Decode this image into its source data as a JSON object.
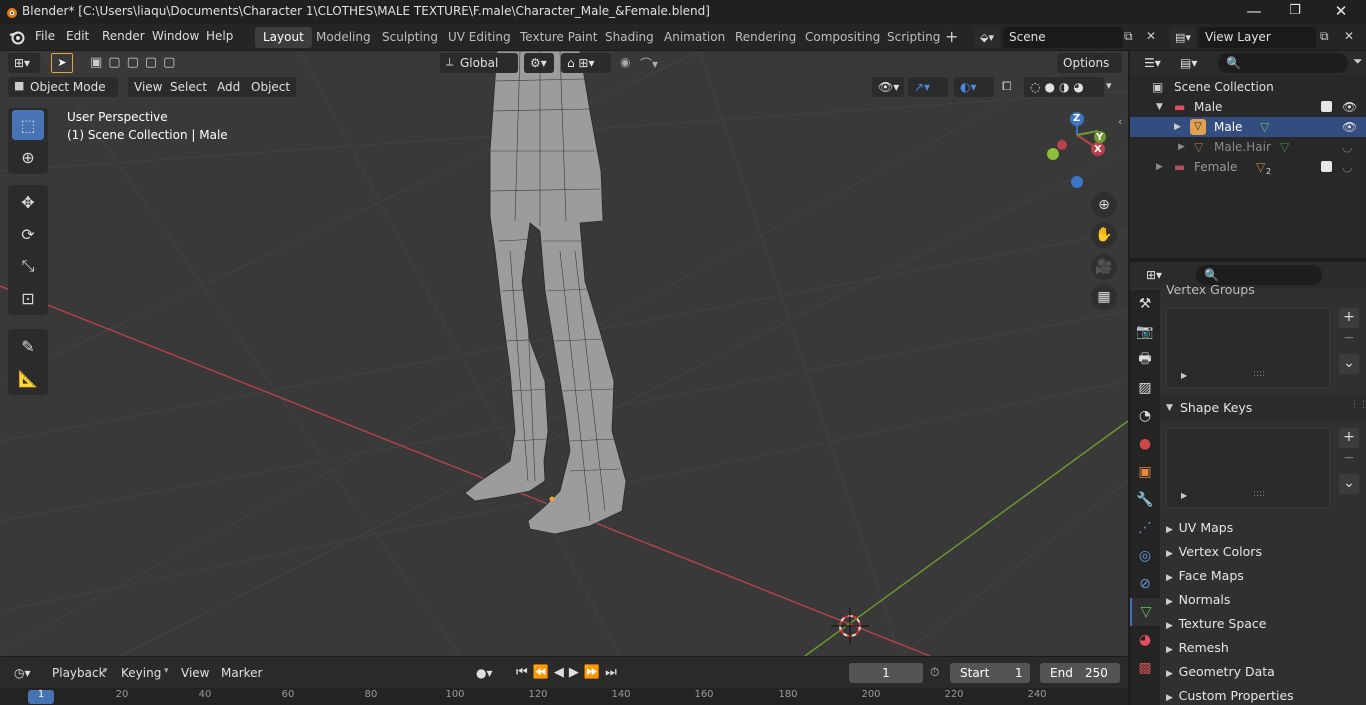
{
  "window": {
    "title": "Blender* [C:\\Users\\liaqu\\Documents\\Character 1\\CLOTHES\\MALE TEXTURE\\F.male\\Character_Male_&Female.blend]",
    "minimize": "—",
    "maximize": "❐",
    "close": "✕"
  },
  "menu": [
    "File",
    "Edit",
    "Render",
    "Window",
    "Help"
  ],
  "workspaces": [
    "Layout",
    "Modeling",
    "Sculpting",
    "UV Editing",
    "Texture Paint",
    "Shading",
    "Animation",
    "Rendering",
    "Compositing",
    "Scripting"
  ],
  "active_workspace": "Layout",
  "scene": {
    "name": "Scene",
    "view_layer": "View Layer"
  },
  "viewport": {
    "transform_orientation": "Global",
    "options_label": "Options",
    "mode": "Object Mode",
    "menus": [
      "View",
      "Select",
      "Add",
      "Object"
    ],
    "perspective_label": "User Perspective",
    "collection_label": "(1) Scene Collection | Male",
    "gizmo_axes": {
      "z": "Z",
      "y": "Y",
      "x": "X"
    }
  },
  "outliner": {
    "root": "Scene Collection",
    "items": [
      {
        "label": "Male",
        "kind": "collection"
      },
      {
        "label": "Male",
        "kind": "object",
        "selected": true
      },
      {
        "label": "Male.Hair",
        "kind": "object"
      },
      {
        "label": "Female",
        "kind": "collection",
        "badge": "2"
      }
    ]
  },
  "properties": {
    "panels": {
      "vertex_groups": "Vertex Groups",
      "shape_keys": "Shape Keys",
      "collapsed": [
        "UV Maps",
        "Vertex Colors",
        "Face Maps",
        "Normals",
        "Texture Space",
        "Remesh",
        "Geometry Data",
        "Custom Properties"
      ]
    }
  },
  "timeline": {
    "menus": [
      "Playback",
      "Keying",
      "View",
      "Marker"
    ],
    "current_frame": "1",
    "start_label": "Start",
    "start": "1",
    "end_label": "End",
    "end": "250",
    "ruler_ticks": [
      "1",
      "20",
      "40",
      "60",
      "80",
      "100",
      "120",
      "140",
      "160",
      "180",
      "200",
      "220",
      "240"
    ]
  },
  "colors": {
    "accent": "#4772b3",
    "x_axis": "#b8414a",
    "y_axis": "#6e9b2e",
    "z_axis": "#3b75c4"
  }
}
